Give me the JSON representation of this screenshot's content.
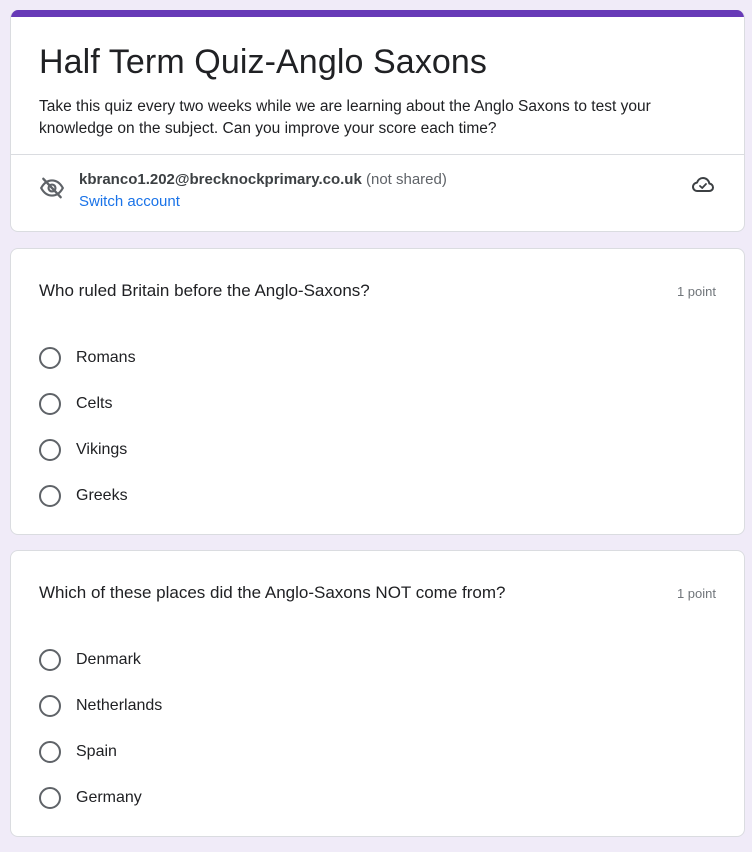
{
  "theme": {
    "accent": "#673ab7",
    "background": "#f0ebf8",
    "link": "#1a73e8"
  },
  "header": {
    "title": "Half Term Quiz-Anglo Saxons",
    "description": "Take this quiz every two weeks while we are learning about the Anglo Saxons to test your knowledge on the subject. Can you improve your score each time?",
    "account_email": "kbranco1.202@brecknockprimary.co.uk",
    "account_note": "(not shared)",
    "switch_account": "Switch account",
    "privacy_icon": "eye-off-icon",
    "save_status_icon": "cloud-icon"
  },
  "questions": [
    {
      "title": "Who ruled Britain before the Anglo-Saxons?",
      "points": "1 point",
      "options": [
        "Romans",
        "Celts",
        "Vikings",
        "Greeks"
      ]
    },
    {
      "title": "Which of these places did the Anglo-Saxons NOT come from?",
      "points": "1 point",
      "options": [
        "Denmark",
        "Netherlands",
        "Spain",
        "Germany"
      ]
    }
  ]
}
